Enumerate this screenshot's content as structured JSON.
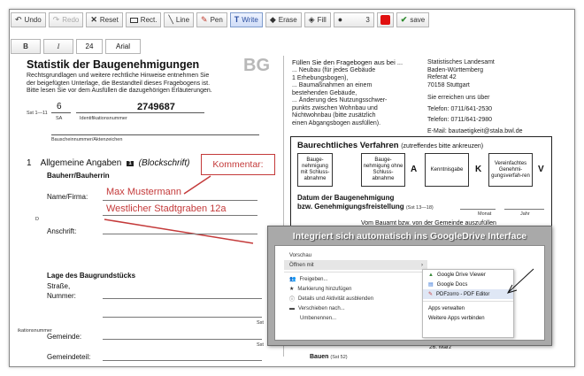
{
  "toolbar": {
    "undo": "Undo",
    "redo": "Redo",
    "reset": "Reset",
    "rect": "Rect.",
    "line": "Line",
    "pen": "Pen",
    "write": "Write",
    "erase": "Erase",
    "fill": "Fill",
    "stroke_value": "3",
    "save": "save",
    "bold": "B",
    "italic": "I",
    "font_size": "24",
    "font_family": "Arial",
    "colors": {
      "pen": "#c0392b",
      "fill_color": "#e01010",
      "save": "#2e8b2e",
      "active": "#2a4ea0"
    }
  },
  "form": {
    "title": "Statistik der Baugenehmigungen",
    "bg_mark": "BG",
    "intro": [
      "Rechtsgrundlagen und weitere rechtliche Hinweise entnehmen Sie",
      "der beigefügten Unterlage, die Bestandteil dieses Fragebogens ist.",
      "Bitte lesen Sie vor dem Ausfüllen die dazugehörigen Erläuterungen."
    ],
    "sst": "Sst 1—11",
    "num_6": "6",
    "sa": "SA",
    "num_id": "2749687",
    "id_label": "Identifikationsnummer",
    "aktenzeichen": "Bauscheinnummer/Aktenzeichen",
    "section1_num": "1",
    "section1_title": "Allgemeine Angaben",
    "section1_badge": "1",
    "section1_sub": "(Blockschrift)",
    "bauherr": "Bauherr/Bauherrin",
    "name_label": "Name/Firma:",
    "d_label": "D",
    "anschrift": "Anschrift:",
    "lage": "Lage des Baugrundstücks",
    "strasse": "Straße,",
    "nummer": "Nummer:",
    "gemeinde": "Gemeinde:",
    "gemeindeteil": "Gemeindeteil:",
    "kennummer": "ikationsnummer",
    "sst_a": "Sst",
    "sst_b": "Sst"
  },
  "annotations": {
    "kommentar": "Kommentar:",
    "name_value": "Max Mustermann",
    "address_value": "Westlicher Stadtgraben 12a"
  },
  "right": {
    "fuellen": "Füllen Sie den Fragebogen aus bei ...",
    "options": [
      "... Neubau (für jedes Gebäude",
      "1 Erhebungsbogen),",
      "... Baumaßnahmen an einem",
      "bestehenden Gebäude,",
      "... Änderung des Nutzungsschwer-",
      "punkts zwischen Wohnbau und",
      "Nichtwohnbau (bitte zusätzlich",
      "einen Abgangsbogen ausfüllen)."
    ],
    "address": [
      "Statistisches Landesamt",
      "Baden-Württemberg",
      "Referat 42",
      "70158 Stuttgart"
    ],
    "erreichen": "Sie erreichen uns über",
    "tel1": "Telefon: 0711/641-2530",
    "tel2": "Telefon: 0711/641-2980",
    "email": "E-Mail:  bautaetigkeit@stala.bwl.de",
    "verfahren_title": "Baurechtliches Verfahren",
    "verfahren_sub": "(zutreffendes bitte ankreuzen)",
    "cells": [
      "Bauge-nehmigung mit Schluss-abnahme",
      "Bauge-nehmigung ohne Schluss-abnahme",
      "Kenntnisgabe",
      "Vereinfachtes Genehmi-gungsverfah-ren"
    ],
    "letters": [
      "A",
      "K",
      "V"
    ],
    "datum": "Datum der Baugenehmigung",
    "datum2": "bzw. Genehmigungsfreistellung",
    "datum_sst": "(Sst 13—18)",
    "monat": "Monat",
    "jahr": "Jahr",
    "vombauamt": "Vom Bauamt bzw. von der Gemeinde auszufüllen",
    "maerz": "26. März",
    "bauen": "Bauen",
    "sst_52": "(Sst 52)"
  },
  "popup": {
    "title": "Integriert sich automatisch ins GoogleDrive Interface",
    "menu": [
      "Vorschau",
      "Öffnen mit",
      "Freigeben...",
      "Markierung hinzufügen",
      "Details und Aktivität ausblenden",
      "Verschieben nach...",
      "Umbenennen..."
    ],
    "submenu": [
      "Google Drive Viewer",
      "Google Docs",
      "PDFzorro - PDF Editor",
      "Apps verwalten",
      "Weitere Apps verbinden"
    ]
  }
}
